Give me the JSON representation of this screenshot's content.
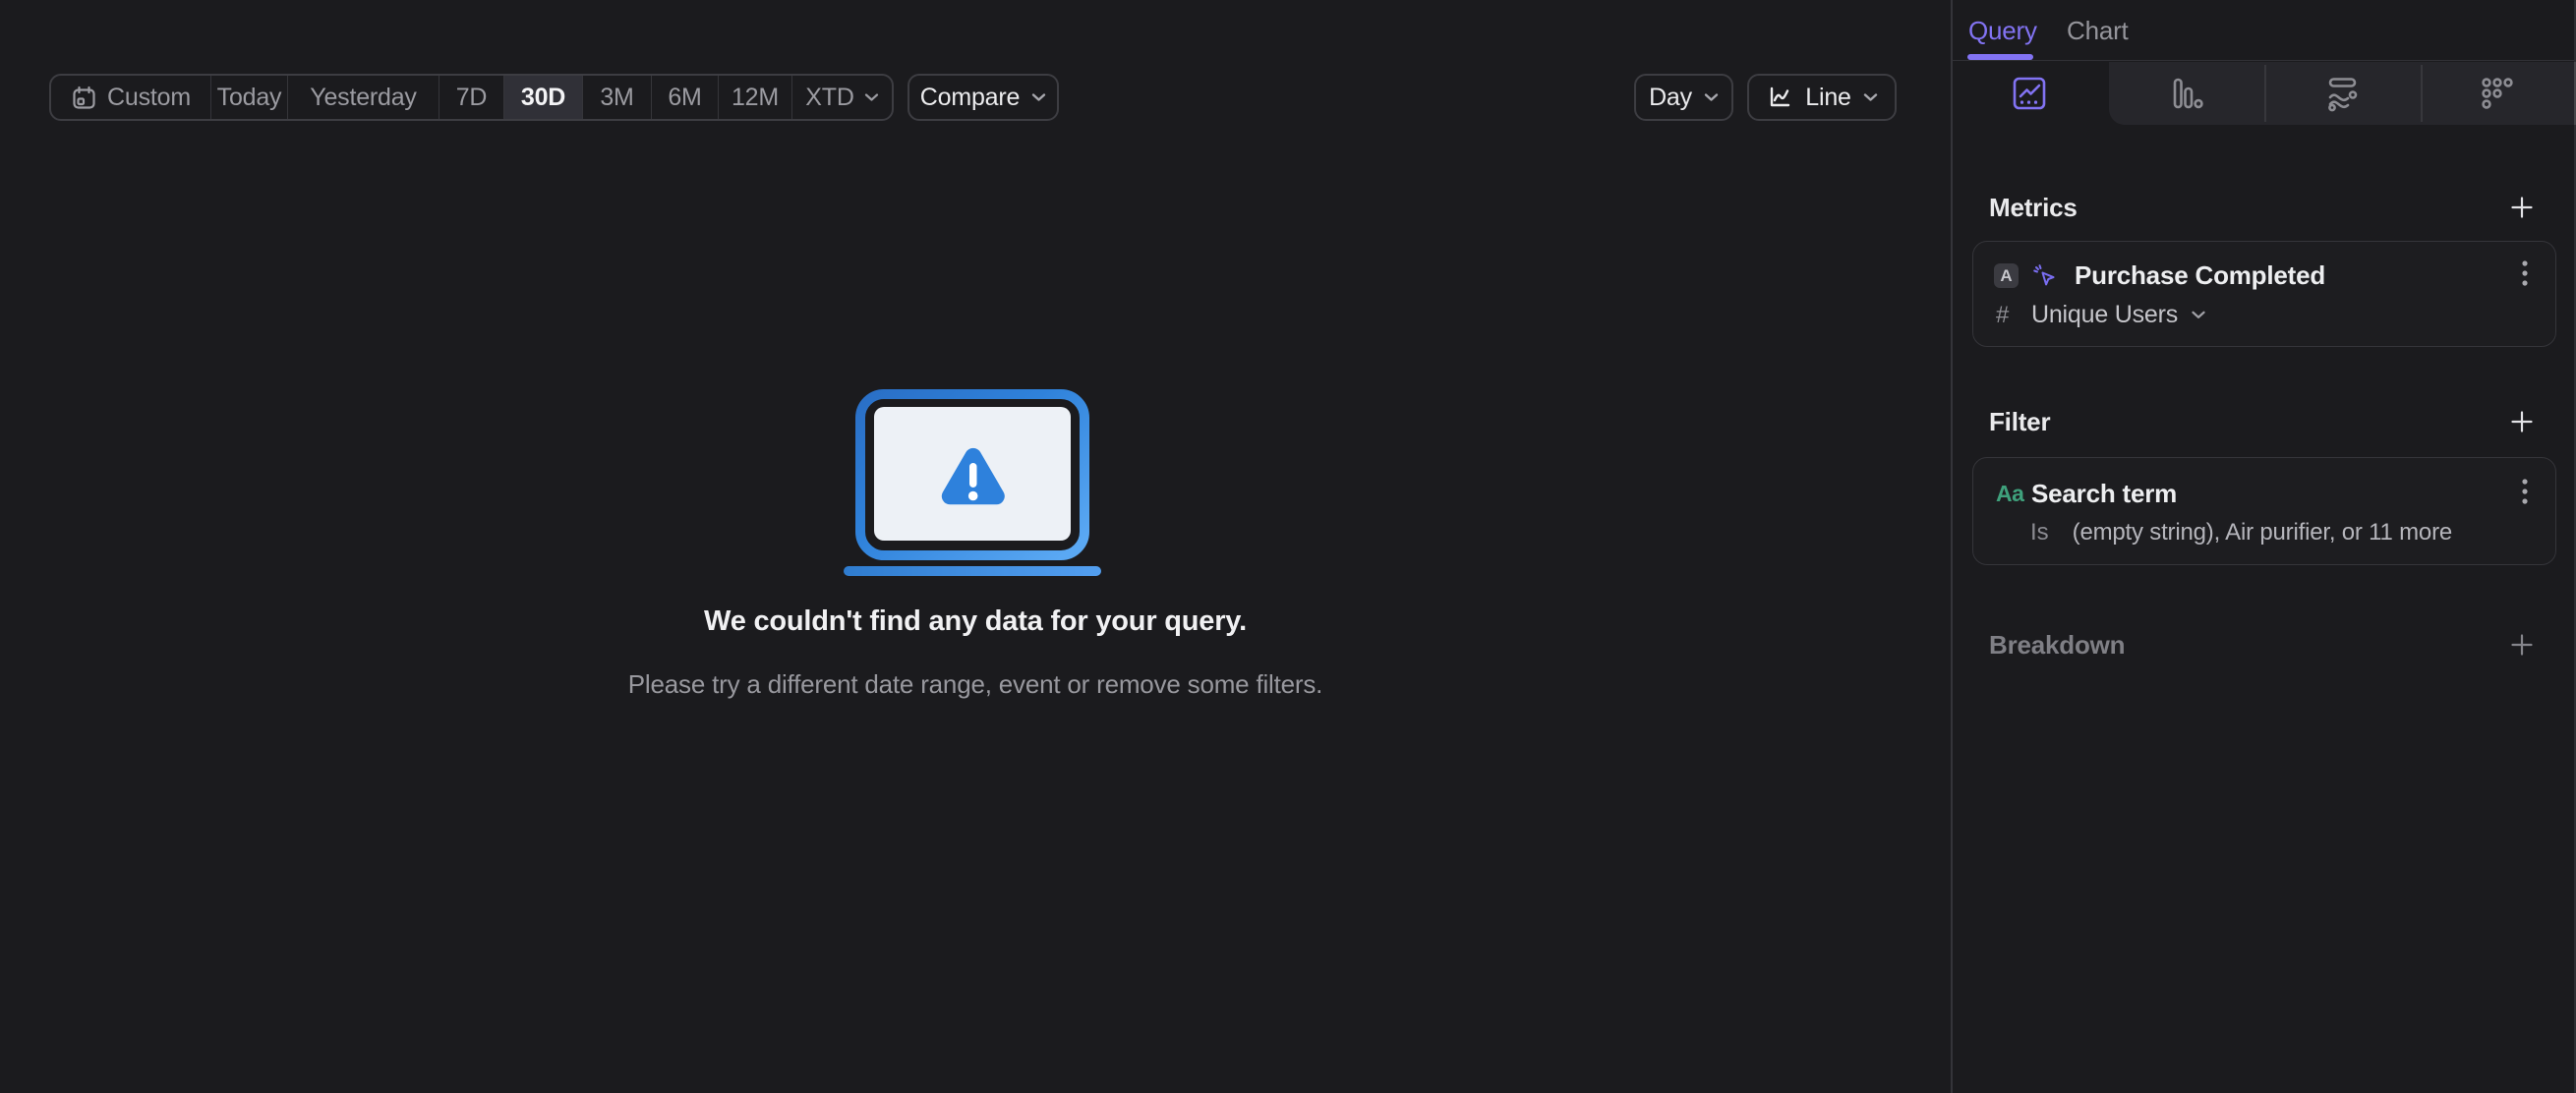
{
  "toolbar": {
    "ranges": [
      {
        "label": "Custom"
      },
      {
        "label": "Today"
      },
      {
        "label": "Yesterday"
      },
      {
        "label": "7D"
      },
      {
        "label": "30D"
      },
      {
        "label": "3M"
      },
      {
        "label": "6M"
      },
      {
        "label": "12M"
      },
      {
        "label": "XTD"
      }
    ],
    "active_range": "30D",
    "compare_label": "Compare",
    "granularity_label": "Day",
    "chart_type_label": "Line"
  },
  "empty_state": {
    "title": "We couldn't find any data for your query.",
    "subtitle": "Please try a different date range, event or remove some filters."
  },
  "sidebar": {
    "tabs": [
      {
        "label": "Query"
      },
      {
        "label": "Chart"
      }
    ],
    "active_tab": "Query",
    "chart_type_tabs": [
      "insights",
      "funnels",
      "flows",
      "retention"
    ],
    "metrics": {
      "heading": "Metrics",
      "items": [
        {
          "letter": "A",
          "event": "Purchase Completed",
          "aggregation_prefix": "#",
          "aggregation": "Unique Users"
        }
      ]
    },
    "filter": {
      "heading": "Filter",
      "items": [
        {
          "type_badge": "Aa",
          "property": "Search term",
          "operator": "Is",
          "value": "(empty string), Air purifier, or 11 more"
        }
      ]
    },
    "breakdown": {
      "heading": "Breakdown"
    }
  },
  "colors": {
    "accent_purple": "#8273f3",
    "empty_state_blue": "#3586e0",
    "string_property_green": "#3fa17c",
    "background": "#1b1b1e"
  }
}
